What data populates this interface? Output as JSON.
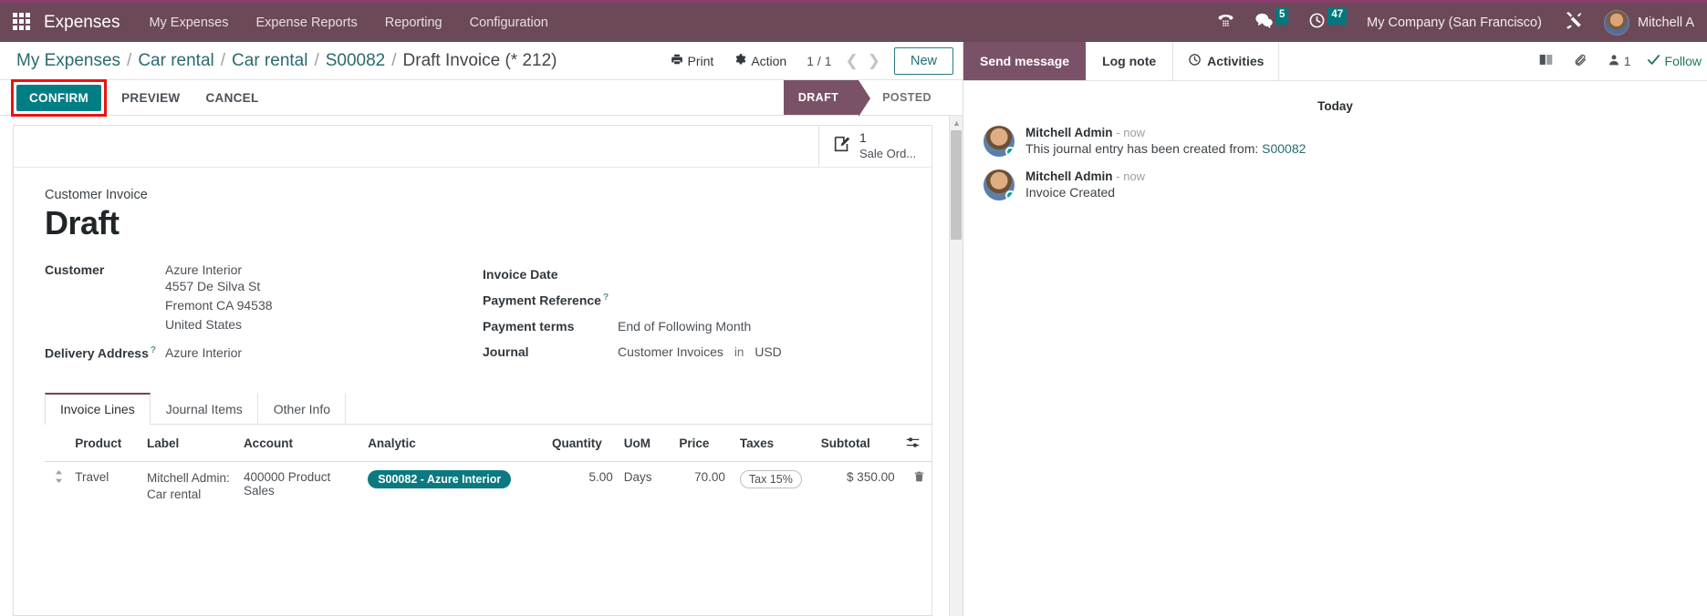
{
  "navbar": {
    "brand": "Expenses",
    "menu": [
      "My Expenses",
      "Expense Reports",
      "Reporting",
      "Configuration"
    ],
    "messages_badge": "5",
    "activities_badge": "47",
    "company": "My Company (San Francisco)",
    "user": "Mitchell A",
    "accent": "#6b4958"
  },
  "control_panel": {
    "breadcrumb": [
      "My Expenses",
      "Car rental",
      "Car rental",
      "S00082"
    ],
    "current": "Draft Invoice (* 212)",
    "print_label": "Print",
    "action_label": "Action",
    "pager": "1 / 1",
    "new_label": "New"
  },
  "action_bar": {
    "confirm_label": "CONFIRM",
    "preview_label": "PREVIEW",
    "cancel_label": "CANCEL",
    "status": [
      "DRAFT",
      "POSTED"
    ],
    "active_status": "DRAFT",
    "highlight_color": "#ee1111"
  },
  "stat_button": {
    "value": "1",
    "label": "Sale Ord..."
  },
  "invoice": {
    "doc_type": "Customer Invoice",
    "title": "Draft",
    "customer_label": "Customer",
    "customer_name": "Azure Interior",
    "customer_address": [
      "4557 De Silva St",
      "Fremont CA 94538",
      "United States"
    ],
    "delivery_label": "Delivery Address",
    "delivery_value": "Azure Interior",
    "invoice_date_label": "Invoice Date",
    "invoice_date_value": "",
    "payment_ref_label": "Payment Reference",
    "payment_ref_value": "",
    "payment_terms_label": "Payment terms",
    "payment_terms_value": "End of Following Month",
    "journal_label": "Journal",
    "journal_value": "Customer Invoices",
    "journal_in": "in",
    "journal_currency": "USD",
    "help_marker": "?"
  },
  "notebook": {
    "tabs": [
      "Invoice Lines",
      "Journal Items",
      "Other Info"
    ],
    "active_tab": "Invoice Lines",
    "columns": [
      "Product",
      "Label",
      "Account",
      "Analytic",
      "Quantity",
      "UoM",
      "Price",
      "Taxes",
      "Subtotal"
    ],
    "rows": [
      {
        "product": "Travel",
        "label": "Mitchell Admin: Car rental",
        "account": "400000 Product Sales",
        "analytic": "S00082 - Azure Interior",
        "quantity": "5.00",
        "uom": "Days",
        "price": "70.00",
        "taxes": "Tax 15%",
        "subtotal": "$ 350.00"
      }
    ],
    "tag_color": "#0a7a80"
  },
  "chatter": {
    "send_message": "Send message",
    "log_note": "Log note",
    "activities": "Activities",
    "followers_count": "1",
    "follow_label": "Follow",
    "today": "Today",
    "messages": [
      {
        "author": "Mitchell Admin",
        "time": "- now",
        "text": "This journal entry has been created from: ",
        "link": "S00082"
      },
      {
        "author": "Mitchell Admin",
        "time": "- now",
        "text": "Invoice Created",
        "link": ""
      }
    ]
  }
}
